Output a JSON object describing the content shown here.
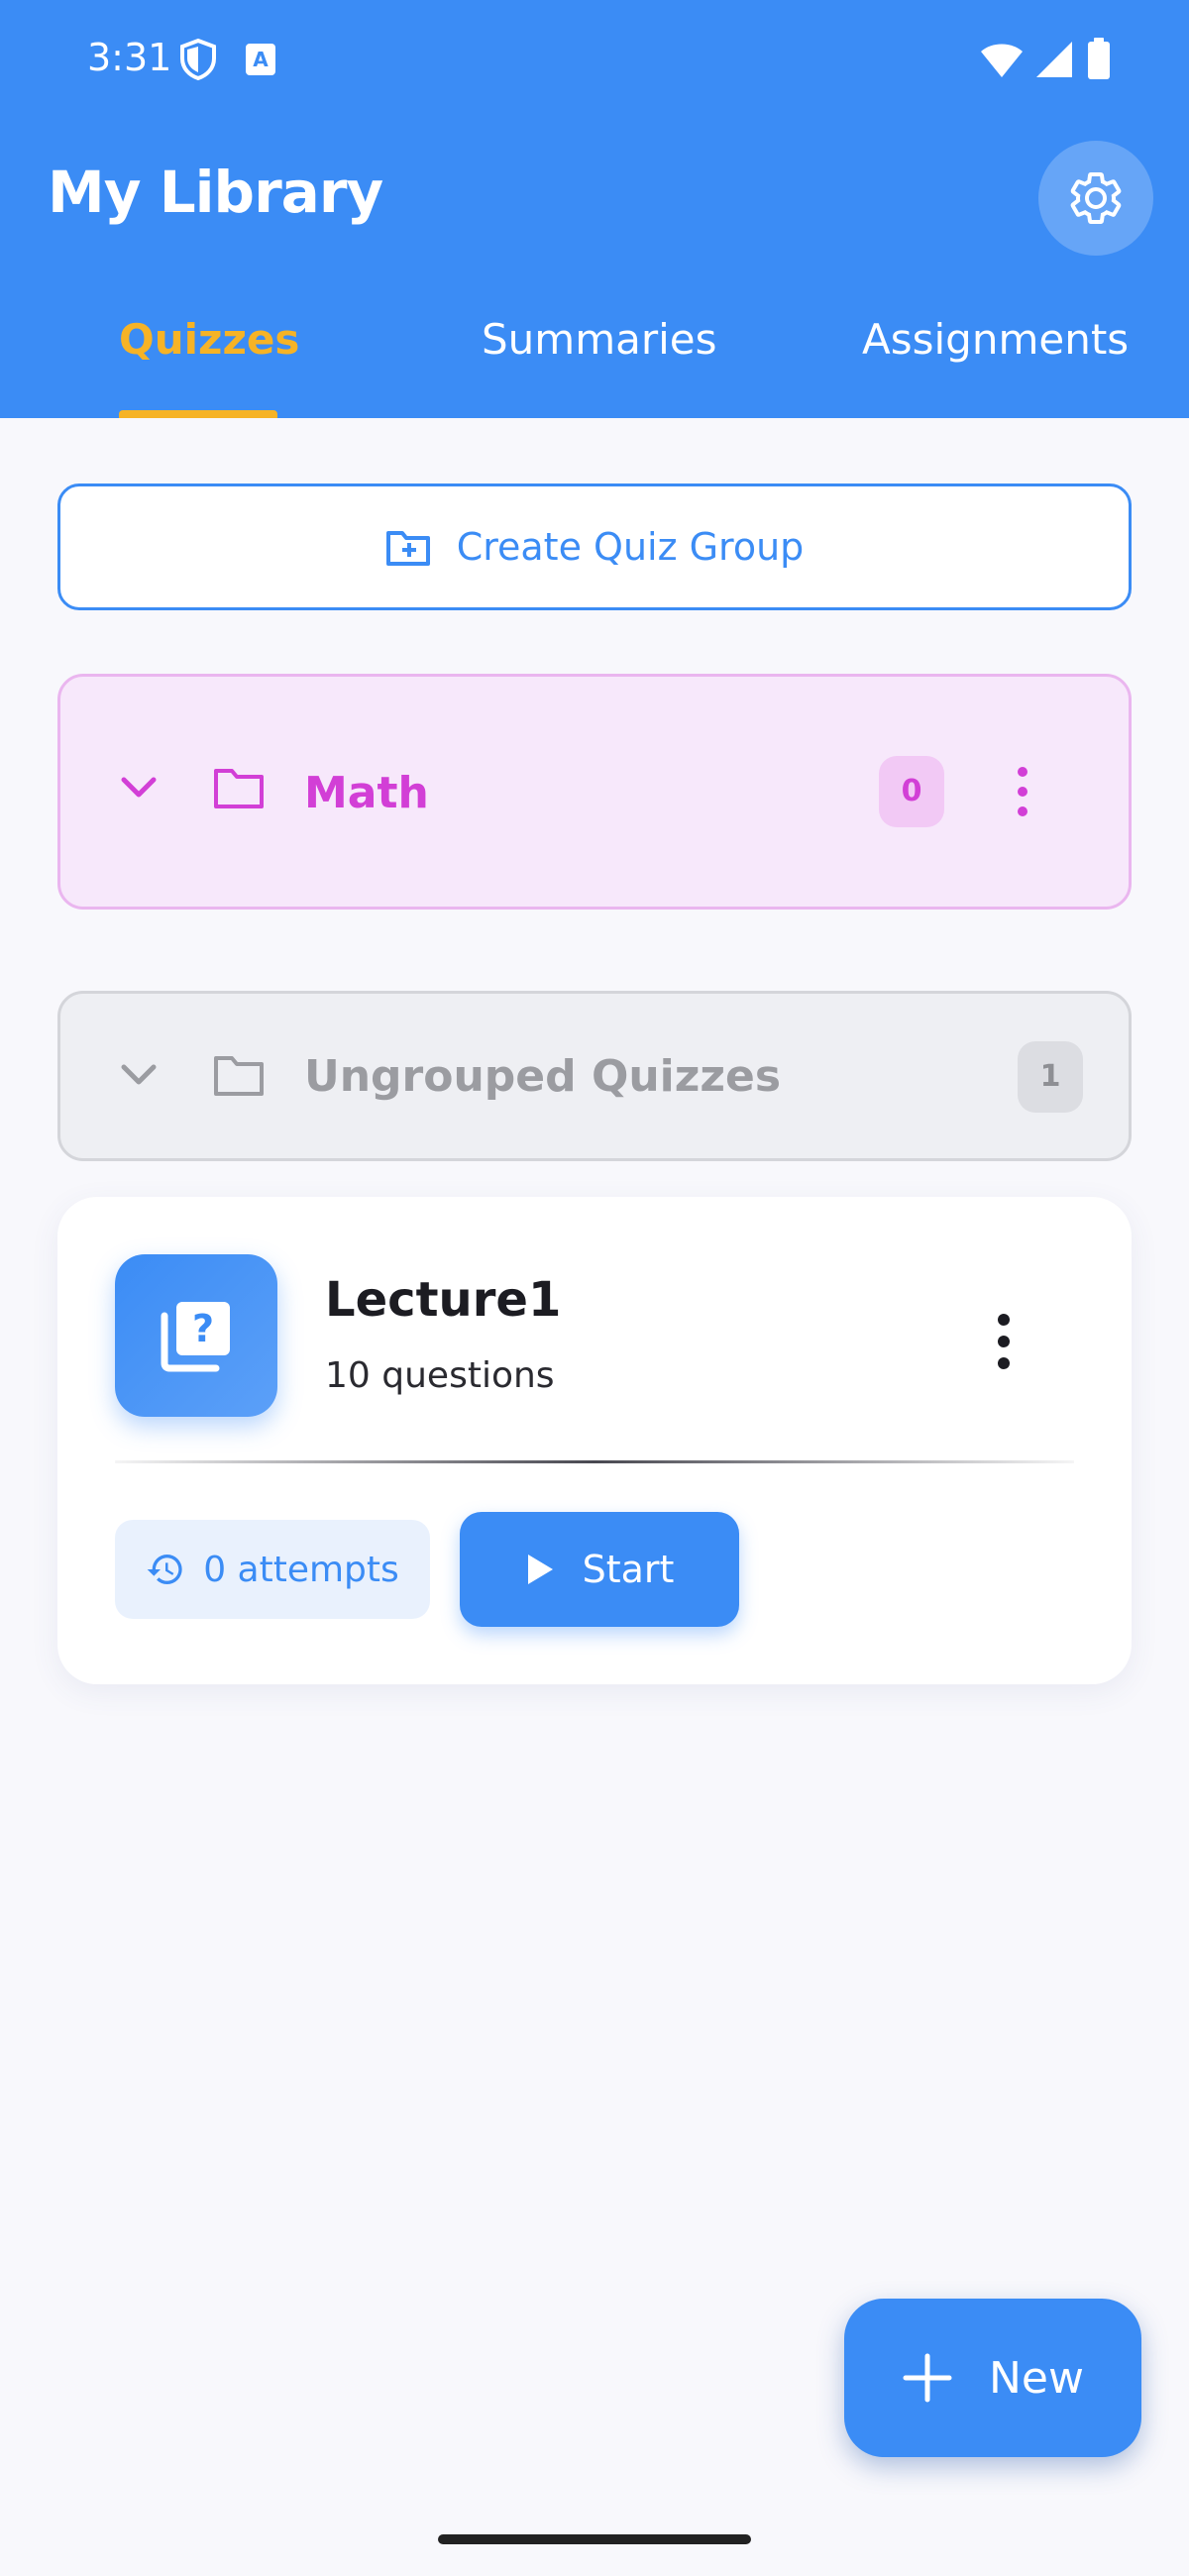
{
  "status_bar": {
    "time": "3:31",
    "icons": [
      "shield-icon",
      "a-badge-icon",
      "wifi-icon",
      "signal-icon",
      "battery-icon"
    ],
    "badge_letter": "A"
  },
  "header": {
    "title": "My Library",
    "settings_icon": "gear-icon"
  },
  "tabs": [
    {
      "label": "Quizzes",
      "selected": true
    },
    {
      "label": "Summaries",
      "selected": false
    },
    {
      "label": "Assignments",
      "selected": false
    }
  ],
  "create_group": {
    "label": "Create Quiz Group",
    "icon": "folder-plus-icon"
  },
  "groups": [
    {
      "name": "Math",
      "count": "0",
      "color": "#d23fd6"
    },
    {
      "name": "Ungrouped Quizzes",
      "count": "1",
      "color": "#9b9ca1"
    }
  ],
  "quiz": {
    "title": "Lecture1",
    "subtitle": "10 questions",
    "attempts_label": "0 attempts",
    "start_label": "Start"
  },
  "fab": {
    "label": "New"
  },
  "colors": {
    "primary": "#3b8cf5",
    "accent": "#f6b326",
    "math_group": "#d23fd6"
  }
}
